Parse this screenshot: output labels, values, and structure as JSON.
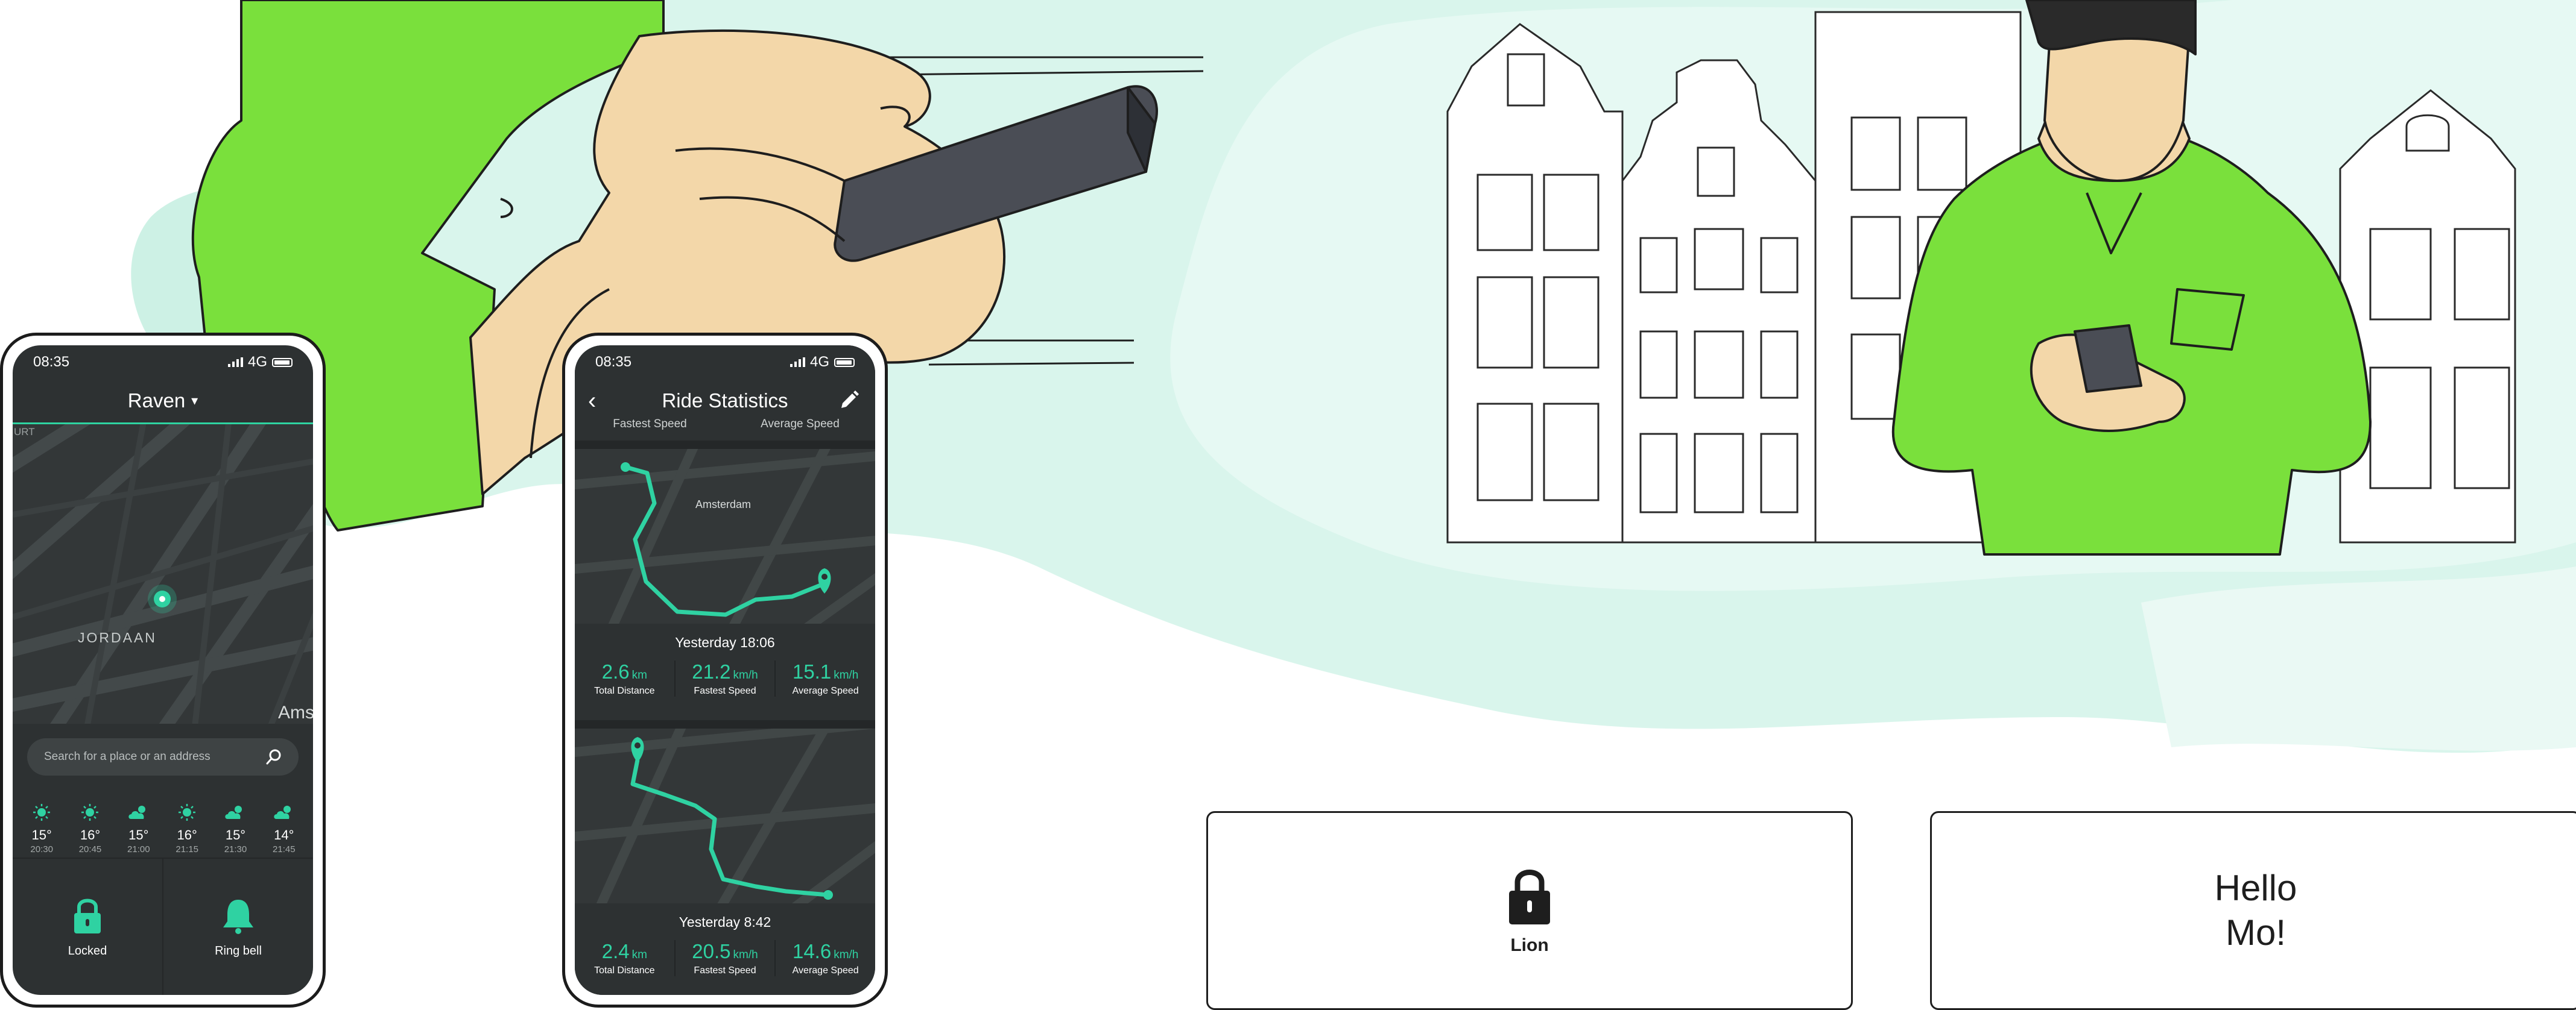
{
  "map_phone": {
    "status": {
      "time": "08:35",
      "network": "4G"
    },
    "title": "Raven",
    "map_labels": {
      "district": "JORDAAN",
      "city_partial": "Ams",
      "edge": "URT"
    },
    "search": {
      "placeholder": "Search for a place or an address"
    },
    "weather": [
      {
        "icon": "sun-icon",
        "temp": "15°",
        "time": "20:30"
      },
      {
        "icon": "sun-icon",
        "temp": "16°",
        "time": "20:45"
      },
      {
        "icon": "cloud-sun-icon",
        "temp": "15°",
        "time": "21:00"
      },
      {
        "icon": "sun-icon",
        "temp": "16°",
        "time": "21:15"
      },
      {
        "icon": "cloud-sun-icon",
        "temp": "15°",
        "time": "21:30"
      },
      {
        "icon": "cloud-sun-icon",
        "temp": "14°",
        "time": "21:45"
      }
    ],
    "actions": [
      {
        "icon": "lock-icon",
        "label": "Locked"
      },
      {
        "icon": "bell-icon",
        "label": "Ring bell"
      }
    ]
  },
  "stats_phone": {
    "status": {
      "time": "08:35",
      "network": "4G"
    },
    "title": "Ride Statistics",
    "cut_labels": [
      "Fastest Speed",
      "Average Speed"
    ],
    "map_label": "Amsterdam",
    "rides": [
      {
        "title": "Yesterday 18:06",
        "stats": [
          {
            "value": "2.6",
            "unit": "km",
            "label": "Total Distance"
          },
          {
            "value": "21.2",
            "unit": "km/h",
            "label": "Fastest Speed"
          },
          {
            "value": "15.1",
            "unit": "km/h",
            "label": "Average Speed"
          }
        ]
      },
      {
        "title": "Yesterday 8:42",
        "stats": [
          {
            "value": "2.4",
            "unit": "km",
            "label": "Total Distance"
          },
          {
            "value": "20.5",
            "unit": "km/h",
            "label": "Fastest Speed"
          },
          {
            "value": "14.6",
            "unit": "km/h",
            "label": "Average Speed"
          }
        ]
      }
    ]
  },
  "lion_card": {
    "icon": "lock-icon",
    "label": "Lion"
  },
  "hello_card": {
    "line1": "Hello",
    "line2": "Mo!"
  },
  "colors": {
    "accent_green": "#2fd2a2",
    "shirt_green": "#7ae03c",
    "mint": "#d8f5ec",
    "skin": "#f3d7a9",
    "screen": "#2d3132"
  }
}
